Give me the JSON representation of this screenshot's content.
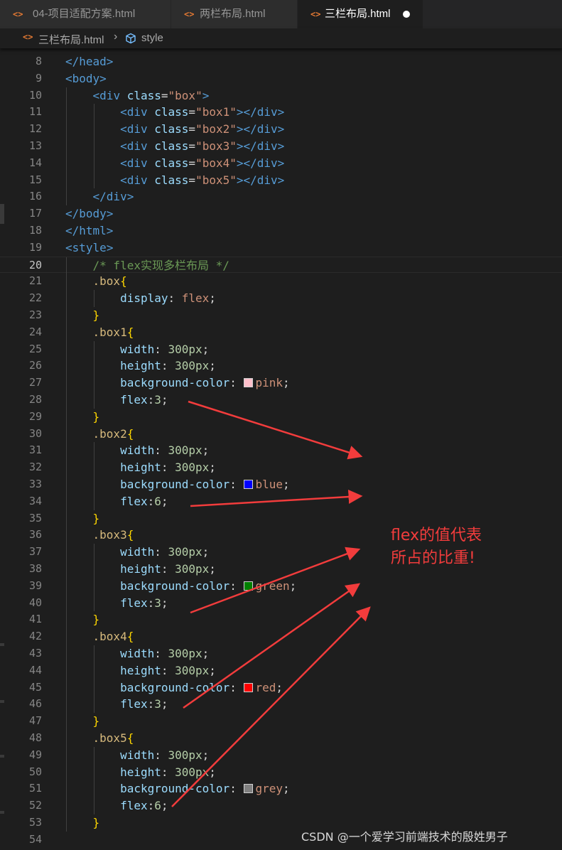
{
  "tabs": [
    {
      "label": "04-项目适配方案.html",
      "icon": "<>",
      "active": false
    },
    {
      "label": "两栏布局.html",
      "icon": "<>",
      "active": false
    },
    {
      "label": "三栏布局.html",
      "icon": "<>",
      "active": true,
      "modified": true
    }
  ],
  "breadcrumb": {
    "file": "三栏布局.html",
    "separator": "›",
    "symbol": "style",
    "file_icon": "<>"
  },
  "colors": {
    "accent_orange": "#e37933",
    "annotation_red": "#f23c3c",
    "editor_bg": "#1e1e1e"
  },
  "current_line": 20,
  "code_lines": [
    {
      "n": 8,
      "tokens": [
        [
          "tag",
          "</"
        ],
        [
          "tag",
          "head"
        ],
        [
          "tag",
          ">"
        ]
      ]
    },
    {
      "n": 9,
      "tokens": [
        [
          "tag",
          "<"
        ],
        [
          "tag",
          "body"
        ],
        [
          "tag",
          ">"
        ]
      ]
    },
    {
      "n": 10,
      "tokens": [
        [
          "tx",
          "    "
        ],
        [
          "tag",
          "<"
        ],
        [
          "tag",
          "div"
        ],
        [
          "tx",
          " "
        ],
        [
          "attr",
          "class"
        ],
        [
          "tx",
          "="
        ],
        [
          "str",
          "\"box\""
        ],
        [
          "tag",
          ">"
        ]
      ]
    },
    {
      "n": 11,
      "tokens": [
        [
          "tx",
          "        "
        ],
        [
          "tag",
          "<"
        ],
        [
          "tag",
          "div"
        ],
        [
          "tx",
          " "
        ],
        [
          "attr",
          "class"
        ],
        [
          "tx",
          "="
        ],
        [
          "str",
          "\"box1\""
        ],
        [
          "tag",
          ">"
        ],
        [
          "tag",
          "</"
        ],
        [
          "tag",
          "div"
        ],
        [
          "tag",
          ">"
        ]
      ]
    },
    {
      "n": 12,
      "tokens": [
        [
          "tx",
          "        "
        ],
        [
          "tag",
          "<"
        ],
        [
          "tag",
          "div"
        ],
        [
          "tx",
          " "
        ],
        [
          "attr",
          "class"
        ],
        [
          "tx",
          "="
        ],
        [
          "str",
          "\"box2\""
        ],
        [
          "tag",
          ">"
        ],
        [
          "tag",
          "</"
        ],
        [
          "tag",
          "div"
        ],
        [
          "tag",
          ">"
        ]
      ]
    },
    {
      "n": 13,
      "tokens": [
        [
          "tx",
          "        "
        ],
        [
          "tag",
          "<"
        ],
        [
          "tag",
          "div"
        ],
        [
          "tx",
          " "
        ],
        [
          "attr",
          "class"
        ],
        [
          "tx",
          "="
        ],
        [
          "str",
          "\"box3\""
        ],
        [
          "tag",
          ">"
        ],
        [
          "tag",
          "</"
        ],
        [
          "tag",
          "div"
        ],
        [
          "tag",
          ">"
        ]
      ]
    },
    {
      "n": 14,
      "tokens": [
        [
          "tx",
          "        "
        ],
        [
          "tag",
          "<"
        ],
        [
          "tag",
          "div"
        ],
        [
          "tx",
          " "
        ],
        [
          "attr",
          "class"
        ],
        [
          "tx",
          "="
        ],
        [
          "str",
          "\"box4\""
        ],
        [
          "tag",
          ">"
        ],
        [
          "tag",
          "</"
        ],
        [
          "tag",
          "div"
        ],
        [
          "tag",
          ">"
        ]
      ]
    },
    {
      "n": 15,
      "tokens": [
        [
          "tx",
          "        "
        ],
        [
          "tag",
          "<"
        ],
        [
          "tag",
          "div"
        ],
        [
          "tx",
          " "
        ],
        [
          "attr",
          "class"
        ],
        [
          "tx",
          "="
        ],
        [
          "str",
          "\"box5\""
        ],
        [
          "tag",
          ">"
        ],
        [
          "tag",
          "</"
        ],
        [
          "tag",
          "div"
        ],
        [
          "tag",
          ">"
        ]
      ]
    },
    {
      "n": 16,
      "tokens": [
        [
          "tx",
          "    "
        ],
        [
          "tag",
          "</"
        ],
        [
          "tag",
          "div"
        ],
        [
          "tag",
          ">"
        ]
      ]
    },
    {
      "n": 17,
      "tokens": [
        [
          "tag",
          "</"
        ],
        [
          "tag",
          "body"
        ],
        [
          "tag",
          ">"
        ]
      ]
    },
    {
      "n": 18,
      "tokens": [
        [
          "tag",
          "</"
        ],
        [
          "tag",
          "html"
        ],
        [
          "tag",
          ">"
        ]
      ]
    },
    {
      "n": 19,
      "tokens": [
        [
          "tag",
          "<"
        ],
        [
          "tag",
          "style"
        ],
        [
          "tag",
          ">"
        ]
      ]
    },
    {
      "n": 20,
      "tokens": [
        [
          "tx",
          "    "
        ],
        [
          "cmt",
          "/* flex实现多栏布局 */"
        ]
      ]
    },
    {
      "n": 21,
      "tokens": [
        [
          "tx",
          "    "
        ],
        [
          "sel",
          ".box"
        ],
        [
          "brace",
          "{"
        ]
      ]
    },
    {
      "n": 22,
      "tokens": [
        [
          "tx",
          "        "
        ],
        [
          "prop",
          "display"
        ],
        [
          "tx",
          ": "
        ],
        [
          "kw",
          "flex"
        ],
        [
          "tx",
          ";"
        ]
      ]
    },
    {
      "n": 23,
      "tokens": [
        [
          "tx",
          "    "
        ],
        [
          "brace",
          "}"
        ]
      ]
    },
    {
      "n": 24,
      "tokens": [
        [
          "tx",
          "    "
        ],
        [
          "sel",
          ".box1"
        ],
        [
          "brace",
          "{"
        ]
      ]
    },
    {
      "n": 25,
      "tokens": [
        [
          "tx",
          "        "
        ],
        [
          "prop",
          "width"
        ],
        [
          "tx",
          ": "
        ],
        [
          "num",
          "300px"
        ],
        [
          "tx",
          ";"
        ]
      ]
    },
    {
      "n": 26,
      "tokens": [
        [
          "tx",
          "        "
        ],
        [
          "prop",
          "height"
        ],
        [
          "tx",
          ": "
        ],
        [
          "num",
          "300px"
        ],
        [
          "tx",
          ";"
        ]
      ]
    },
    {
      "n": 27,
      "tokens": [
        [
          "tx",
          "        "
        ],
        [
          "prop",
          "background-color"
        ],
        [
          "tx",
          ": "
        ],
        [
          "sw",
          "#ffc0cb"
        ],
        [
          "kw",
          "pink"
        ],
        [
          "tx",
          ";"
        ]
      ]
    },
    {
      "n": 28,
      "tokens": [
        [
          "tx",
          "        "
        ],
        [
          "prop",
          "flex"
        ],
        [
          "tx",
          ":"
        ],
        [
          "num",
          "3"
        ],
        [
          "tx",
          ";"
        ]
      ]
    },
    {
      "n": 29,
      "tokens": [
        [
          "tx",
          "    "
        ],
        [
          "brace",
          "}"
        ]
      ]
    },
    {
      "n": 30,
      "tokens": [
        [
          "tx",
          "    "
        ],
        [
          "sel",
          ".box2"
        ],
        [
          "brace",
          "{"
        ]
      ]
    },
    {
      "n": 31,
      "tokens": [
        [
          "tx",
          "        "
        ],
        [
          "prop",
          "width"
        ],
        [
          "tx",
          ": "
        ],
        [
          "num",
          "300px"
        ],
        [
          "tx",
          ";"
        ]
      ]
    },
    {
      "n": 32,
      "tokens": [
        [
          "tx",
          "        "
        ],
        [
          "prop",
          "height"
        ],
        [
          "tx",
          ": "
        ],
        [
          "num",
          "300px"
        ],
        [
          "tx",
          ";"
        ]
      ]
    },
    {
      "n": 33,
      "tokens": [
        [
          "tx",
          "        "
        ],
        [
          "prop",
          "background-color"
        ],
        [
          "tx",
          ": "
        ],
        [
          "sw",
          "#0000ff"
        ],
        [
          "kw",
          "blue"
        ],
        [
          "tx",
          ";"
        ]
      ]
    },
    {
      "n": 34,
      "tokens": [
        [
          "tx",
          "        "
        ],
        [
          "prop",
          "flex"
        ],
        [
          "tx",
          ":"
        ],
        [
          "num",
          "6"
        ],
        [
          "tx",
          ";"
        ]
      ]
    },
    {
      "n": 35,
      "tokens": [
        [
          "tx",
          "    "
        ],
        [
          "brace",
          "}"
        ]
      ]
    },
    {
      "n": 36,
      "tokens": [
        [
          "tx",
          "    "
        ],
        [
          "sel",
          ".box3"
        ],
        [
          "brace",
          "{"
        ]
      ]
    },
    {
      "n": 37,
      "tokens": [
        [
          "tx",
          "        "
        ],
        [
          "prop",
          "width"
        ],
        [
          "tx",
          ": "
        ],
        [
          "num",
          "300px"
        ],
        [
          "tx",
          ";"
        ]
      ]
    },
    {
      "n": 38,
      "tokens": [
        [
          "tx",
          "        "
        ],
        [
          "prop",
          "height"
        ],
        [
          "tx",
          ": "
        ],
        [
          "num",
          "300px"
        ],
        [
          "tx",
          ";"
        ]
      ]
    },
    {
      "n": 39,
      "tokens": [
        [
          "tx",
          "        "
        ],
        [
          "prop",
          "background-color"
        ],
        [
          "tx",
          ": "
        ],
        [
          "sw",
          "#008000"
        ],
        [
          "kw",
          "green"
        ],
        [
          "tx",
          ";"
        ]
      ]
    },
    {
      "n": 40,
      "tokens": [
        [
          "tx",
          "        "
        ],
        [
          "prop",
          "flex"
        ],
        [
          "tx",
          ":"
        ],
        [
          "num",
          "3"
        ],
        [
          "tx",
          ";"
        ]
      ]
    },
    {
      "n": 41,
      "tokens": [
        [
          "tx",
          "    "
        ],
        [
          "brace",
          "}"
        ]
      ]
    },
    {
      "n": 42,
      "tokens": [
        [
          "tx",
          "    "
        ],
        [
          "sel",
          ".box4"
        ],
        [
          "brace",
          "{"
        ]
      ]
    },
    {
      "n": 43,
      "tokens": [
        [
          "tx",
          "        "
        ],
        [
          "prop",
          "width"
        ],
        [
          "tx",
          ": "
        ],
        [
          "num",
          "300px"
        ],
        [
          "tx",
          ";"
        ]
      ]
    },
    {
      "n": 44,
      "tokens": [
        [
          "tx",
          "        "
        ],
        [
          "prop",
          "height"
        ],
        [
          "tx",
          ": "
        ],
        [
          "num",
          "300px"
        ],
        [
          "tx",
          ";"
        ]
      ]
    },
    {
      "n": 45,
      "tokens": [
        [
          "tx",
          "        "
        ],
        [
          "prop",
          "background-color"
        ],
        [
          "tx",
          ": "
        ],
        [
          "sw",
          "#ff0000"
        ],
        [
          "kw",
          "red"
        ],
        [
          "tx",
          ";"
        ]
      ]
    },
    {
      "n": 46,
      "tokens": [
        [
          "tx",
          "        "
        ],
        [
          "prop",
          "flex"
        ],
        [
          "tx",
          ":"
        ],
        [
          "num",
          "3"
        ],
        [
          "tx",
          ";"
        ]
      ]
    },
    {
      "n": 47,
      "tokens": [
        [
          "tx",
          "    "
        ],
        [
          "brace",
          "}"
        ]
      ]
    },
    {
      "n": 48,
      "tokens": [
        [
          "tx",
          "    "
        ],
        [
          "sel",
          ".box5"
        ],
        [
          "brace",
          "{"
        ]
      ]
    },
    {
      "n": 49,
      "tokens": [
        [
          "tx",
          "        "
        ],
        [
          "prop",
          "width"
        ],
        [
          "tx",
          ": "
        ],
        [
          "num",
          "300px"
        ],
        [
          "tx",
          ";"
        ]
      ]
    },
    {
      "n": 50,
      "tokens": [
        [
          "tx",
          "        "
        ],
        [
          "prop",
          "height"
        ],
        [
          "tx",
          ": "
        ],
        [
          "num",
          "300px"
        ],
        [
          "tx",
          ";"
        ]
      ]
    },
    {
      "n": 51,
      "tokens": [
        [
          "tx",
          "        "
        ],
        [
          "prop",
          "background-color"
        ],
        [
          "tx",
          ": "
        ],
        [
          "sw",
          "#808080"
        ],
        [
          "kw",
          "grey"
        ],
        [
          "tx",
          ";"
        ]
      ]
    },
    {
      "n": 52,
      "tokens": [
        [
          "tx",
          "        "
        ],
        [
          "prop",
          "flex"
        ],
        [
          "tx",
          ":"
        ],
        [
          "num",
          "6"
        ],
        [
          "tx",
          ";"
        ]
      ]
    },
    {
      "n": 53,
      "tokens": [
        [
          "tx",
          "    "
        ],
        [
          "brace",
          "}"
        ]
      ]
    },
    {
      "n": 54,
      "tokens": []
    }
  ],
  "annotation": {
    "line1": "flex的值代表",
    "line2": "所占的比重!"
  },
  "watermark": "CSDN @一个爱学习前端技术的殷姓男子"
}
